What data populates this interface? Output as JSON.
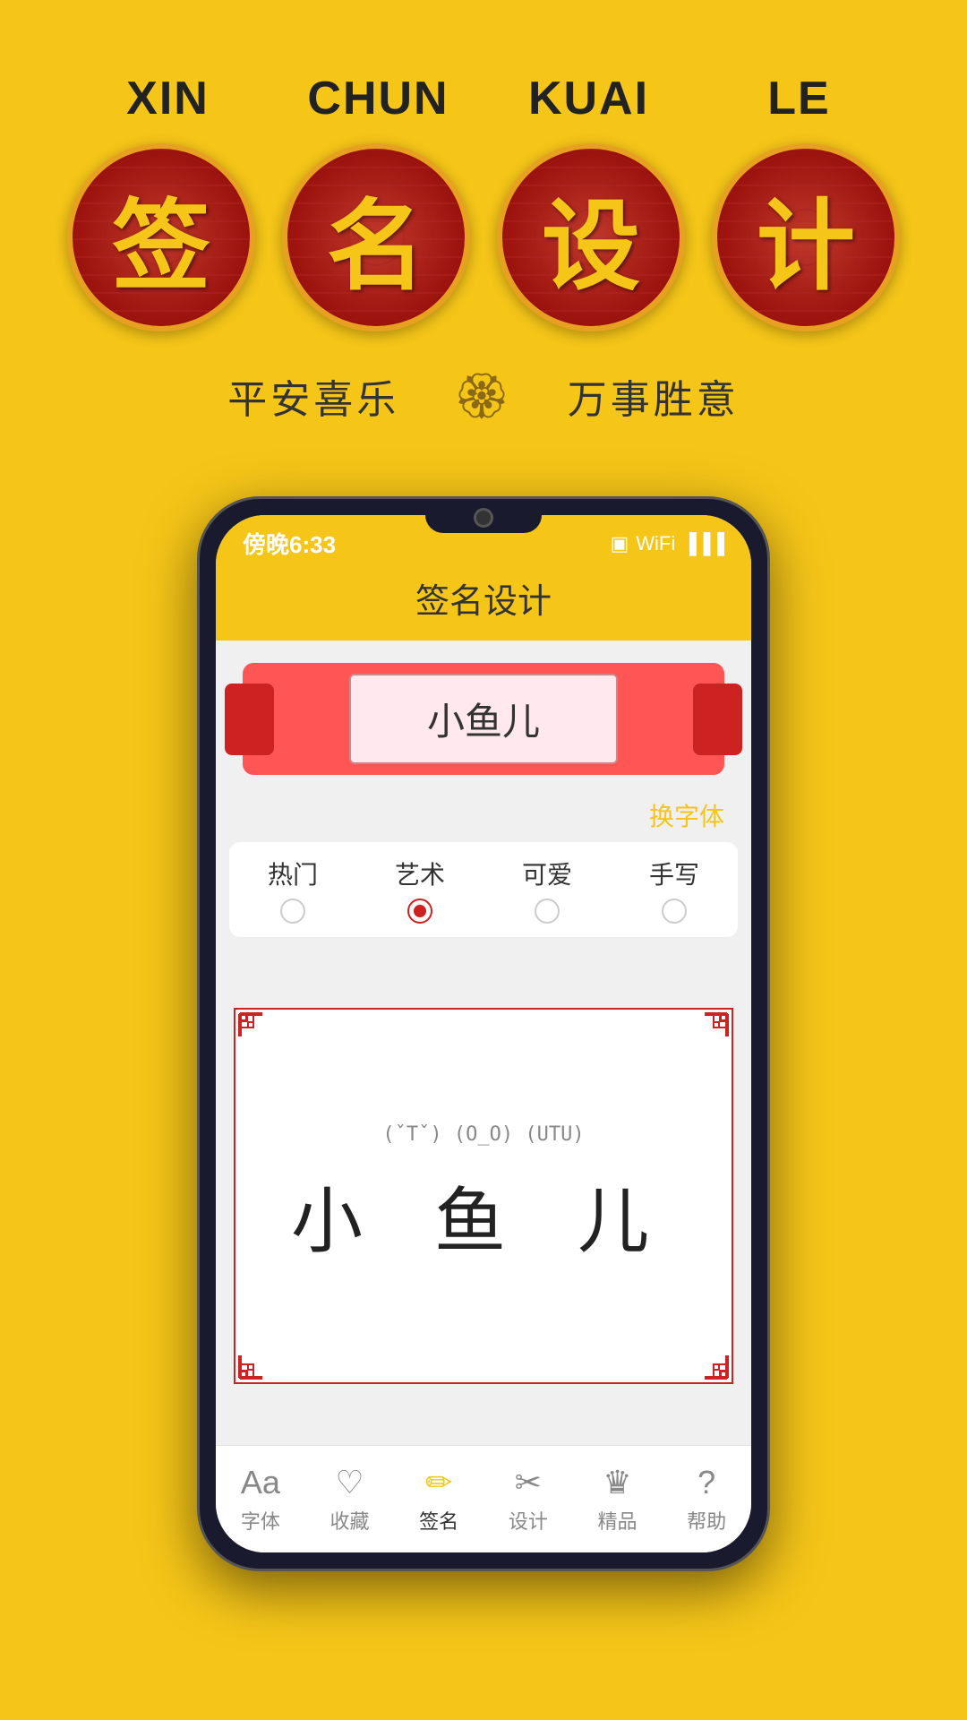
{
  "background_color": "#F5C518",
  "top_section": {
    "pinyin_labels": [
      "XIN",
      "CHUN",
      "KUAI",
      "LE"
    ],
    "chinese_chars": [
      "签",
      "名",
      "设",
      "计"
    ],
    "left_text": "平安喜乐",
    "right_text": "万事胜意",
    "lotus_symbol": "🏵"
  },
  "phone": {
    "status_time": "傍晚6:33",
    "app_title": "签名设计",
    "scroll_name": "小鱼儿",
    "change_font_label": "换字体",
    "tabs": [
      {
        "label": "热门",
        "active": false
      },
      {
        "label": "艺术",
        "active": true
      },
      {
        "label": "可爱",
        "active": false
      },
      {
        "label": "手写",
        "active": false
      }
    ],
    "preview_annotation": "(ˇTˇ) (O_O) (UTU)",
    "preview_name": "小  鱼  儿",
    "nav_items": [
      {
        "label": "字体",
        "icon": "Aa",
        "active": false
      },
      {
        "label": "收藏",
        "icon": "♡",
        "active": false
      },
      {
        "label": "签名",
        "icon": "✏",
        "active": true
      },
      {
        "label": "设计",
        "icon": "✂",
        "active": false
      },
      {
        "label": "精品",
        "icon": "♛",
        "active": false
      },
      {
        "label": "帮助",
        "icon": "?",
        "active": false
      }
    ]
  }
}
